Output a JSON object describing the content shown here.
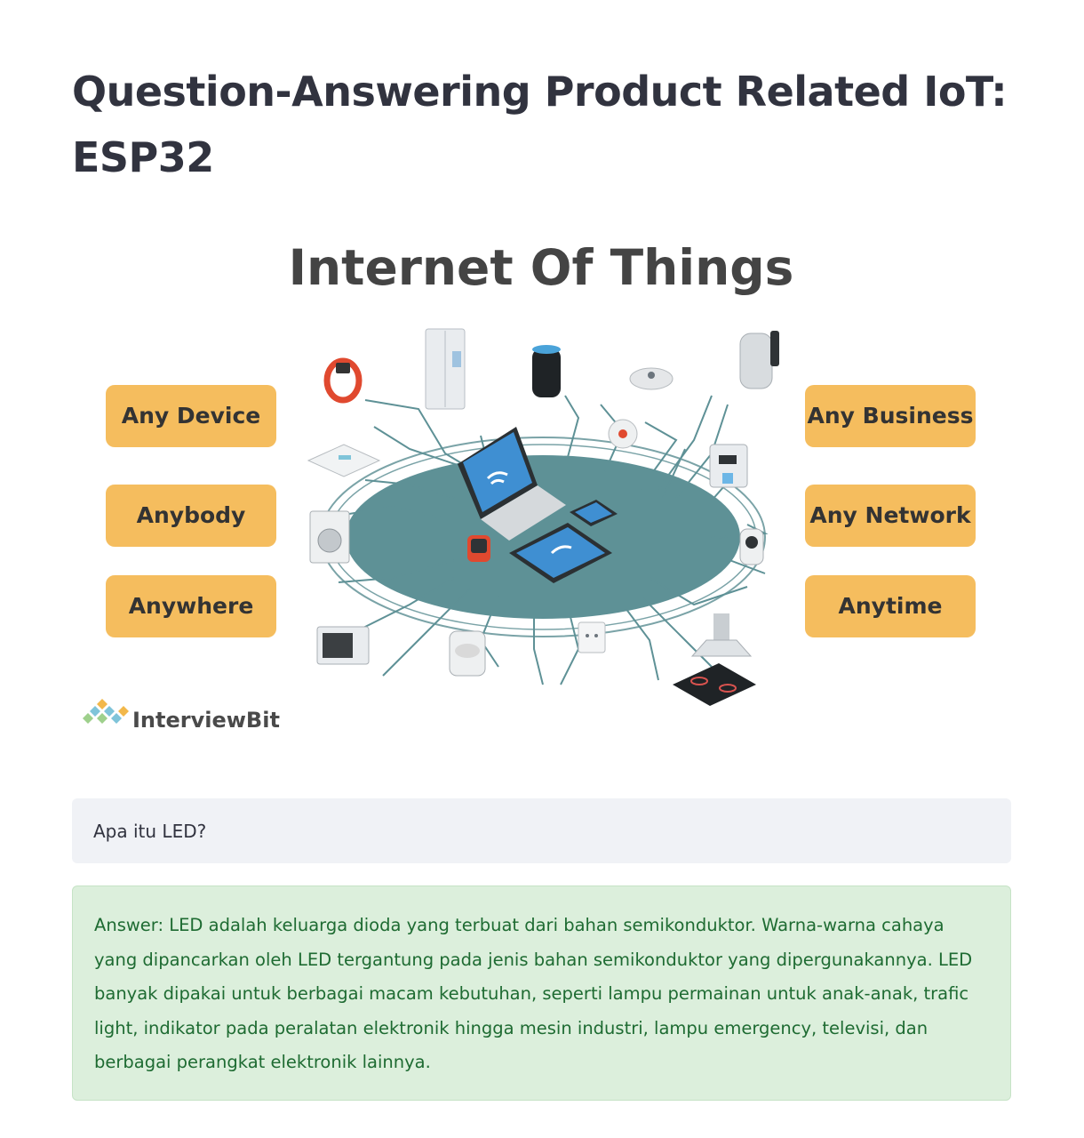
{
  "page": {
    "title": "Question-Answering Product Related IoT: ESP32"
  },
  "figure": {
    "heading": "Internet Of Things",
    "left_labels": [
      "Any Device",
      "Anybody",
      "Anywhere"
    ],
    "right_labels": [
      "Any Business",
      "Any Network",
      "Anytime"
    ],
    "brand": "InterviewBit",
    "label_color": "#f5bd5e",
    "hub_color": "#5e9196",
    "devices": [
      "fitness-band",
      "refrigerator",
      "smart-speaker",
      "robot-vacuum",
      "kettle",
      "smoke-detector",
      "coffee-machine",
      "security-camera",
      "range-hood",
      "cooktop",
      "wall-socket",
      "rice-cooker",
      "microwave",
      "washing-machine",
      "bathroom-scale",
      "laptop",
      "tablet",
      "smartphone",
      "smartwatch"
    ]
  },
  "question": {
    "text": "Apa itu LED?"
  },
  "answer": {
    "text": "Answer: LED adalah keluarga dioda yang terbuat dari bahan semikonduktor. Warna-warna cahaya yang dipancarkan oleh LED tergantung pada jenis bahan semikonduktor yang dipergunakannya. LED banyak dipakai untuk berbagai macam kebutuhan, seperti lampu permainan untuk anak-anak, trafic light, indikator pada peralatan elektronik hingga mesin industri, lampu emergency, televisi, dan berbagai perangkat elektronik lainnya."
  },
  "colors": {
    "title": "#31333f",
    "question_bg": "#f0f2f6",
    "answer_bg": "#dcefdc",
    "answer_text": "#1e6b32"
  }
}
